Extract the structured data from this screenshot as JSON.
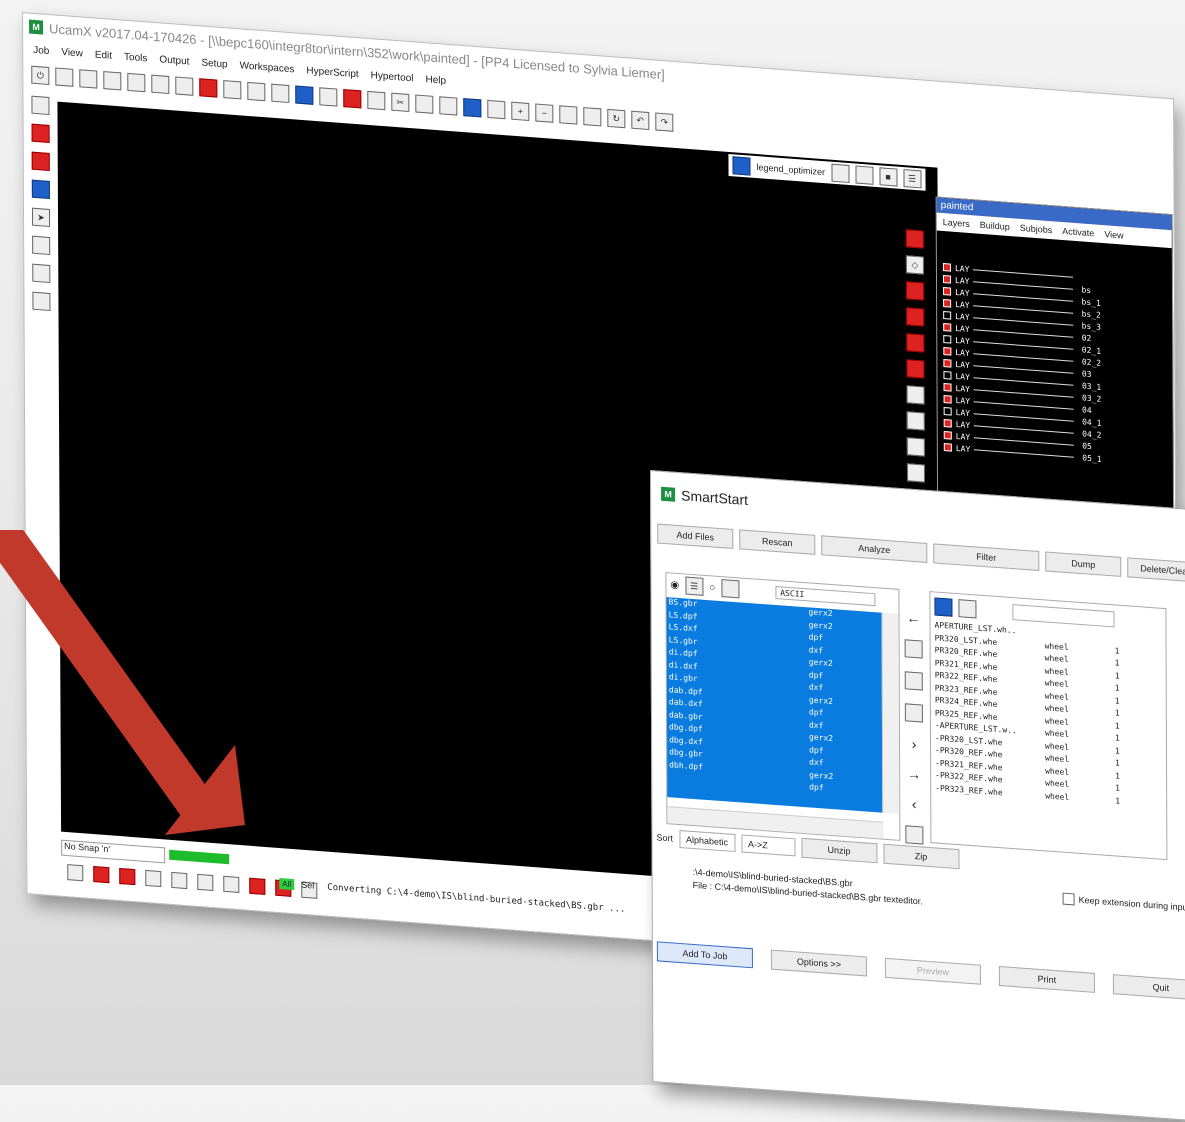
{
  "app": {
    "title": "UcamX v2017.04-170426 - [\\\\bepc160\\integr8tor\\intern\\352\\work\\painted] - [PP4 Licensed to Sylvia Liemer]",
    "logo": "M"
  },
  "menu": [
    "Job",
    "View",
    "Edit",
    "Tools",
    "Output",
    "Setup",
    "Workspaces",
    "HyperScript",
    "Hypertool",
    "Help"
  ],
  "canvas_toolbar": {
    "legend_label": "legend_optimizer"
  },
  "painted_panel": {
    "title": "painted",
    "tabs": [
      "Layers",
      "Buildup",
      "Subjobs",
      "Activate",
      "View"
    ],
    "layers": [
      {
        "tag": "LAY",
        "name": "",
        "on": true
      },
      {
        "tag": "LAY",
        "name": "bs",
        "on": true
      },
      {
        "tag": "LAY",
        "name": "bs_1",
        "on": true
      },
      {
        "tag": "LAY",
        "name": "bs_2",
        "on": true
      },
      {
        "tag": "LAY",
        "name": "bs_3",
        "on": false
      },
      {
        "tag": "LAY",
        "name": "02",
        "on": true
      },
      {
        "tag": "LAY",
        "name": "02_1",
        "on": false
      },
      {
        "tag": "LAY",
        "name": "02_2",
        "on": true
      },
      {
        "tag": "LAY",
        "name": "03",
        "on": true
      },
      {
        "tag": "LAY",
        "name": "03_1",
        "on": false
      },
      {
        "tag": "LAY",
        "name": "03_2",
        "on": true
      },
      {
        "tag": "LAY",
        "name": "04",
        "on": true
      },
      {
        "tag": "LAY",
        "name": "04_1",
        "on": false
      },
      {
        "tag": "LAY",
        "name": "04_2",
        "on": true
      },
      {
        "tag": "LAY",
        "name": "05",
        "on": true
      },
      {
        "tag": "LAY",
        "name": "05_1",
        "on": true
      }
    ]
  },
  "status": {
    "snap": "No Snap 'n'",
    "all": "All",
    "sel": "Sel",
    "converting": "Converting C:\\4-demo\\IS\\blind-buried-stacked\\BS.gbr ..."
  },
  "smartstart": {
    "title": "SmartStart",
    "buttons": [
      "Add Files",
      "Rescan",
      "Analyze",
      "Filter",
      "Dump",
      "Delete/Clean"
    ],
    "left_header": "ASCII",
    "left_files": [
      {
        "name": "BS.gbr",
        "type": "gerx2"
      },
      {
        "name": "LS.dpf",
        "type": "gerx2"
      },
      {
        "name": "LS.dxf",
        "type": "dpf"
      },
      {
        "name": "LS.gbr",
        "type": "dxf"
      },
      {
        "name": "di.dpf",
        "type": "gerx2"
      },
      {
        "name": "di.dxf",
        "type": "dpf"
      },
      {
        "name": "di.gbr",
        "type": "dxf"
      },
      {
        "name": "dab.dpf",
        "type": "gerx2"
      },
      {
        "name": "dab.dxf",
        "type": "dpf"
      },
      {
        "name": "dab.gbr",
        "type": "dxf"
      },
      {
        "name": "dbg.dpf",
        "type": "gerx2"
      },
      {
        "name": "dbg.dxf",
        "type": "dpf"
      },
      {
        "name": "dbg.gbr",
        "type": "dxf"
      },
      {
        "name": "dbh.dpf",
        "type": "gerx2"
      },
      {
        "name": "",
        "type": "dpf"
      }
    ],
    "right_files": [
      {
        "name": "APERTURE_LST.wh..",
        "type": "",
        "n": ""
      },
      {
        "name": "PR320_LST.whe",
        "type": "wheel",
        "n": "1"
      },
      {
        "name": "PR320_REF.whe",
        "type": "wheel",
        "n": "1"
      },
      {
        "name": "PR321_REF.whe",
        "type": "wheel",
        "n": "1"
      },
      {
        "name": "PR322_REF.whe",
        "type": "wheel",
        "n": "1"
      },
      {
        "name": "PR323_REF.whe",
        "type": "wheel",
        "n": "1"
      },
      {
        "name": "PR324_REF.whe",
        "type": "wheel",
        "n": "1"
      },
      {
        "name": "PR325_REF.whe",
        "type": "wheel",
        "n": "1"
      },
      {
        "name": "-APERTURE_LST.w..",
        "type": "wheel",
        "n": "1"
      },
      {
        "name": "-PR320_LST.whe",
        "type": "wheel",
        "n": "1"
      },
      {
        "name": "-PR320_REF.whe",
        "type": "wheel",
        "n": "1"
      },
      {
        "name": "-PR321_REF.whe",
        "type": "wheel",
        "n": "1"
      },
      {
        "name": "-PR322_REF.whe",
        "type": "wheel",
        "n": "1"
      },
      {
        "name": "-PR323_REF.whe",
        "type": "wheel",
        "n": "1"
      }
    ],
    "sort_label": "Sort",
    "sort_value": "Alphabetic",
    "order_value": "A->Z",
    "unzip": "Unzip",
    "zip": "Zip",
    "path_line": ":\\4-demo\\IS\\blind-buried-stacked\\BS.gbr",
    "file_line": "File : C:\\4-demo\\IS\\blind-buried-stacked\\BS.gbr texteditor.",
    "keep_label": "Keep extension during input",
    "bottom_buttons": [
      "Add To Job",
      "Options >>",
      "Preview",
      "Print",
      "Quit"
    ]
  },
  "colors": {
    "accent_red": "#c0392b",
    "list_blue": "#0a7ce0",
    "progress_green": "#1ebc2c"
  }
}
